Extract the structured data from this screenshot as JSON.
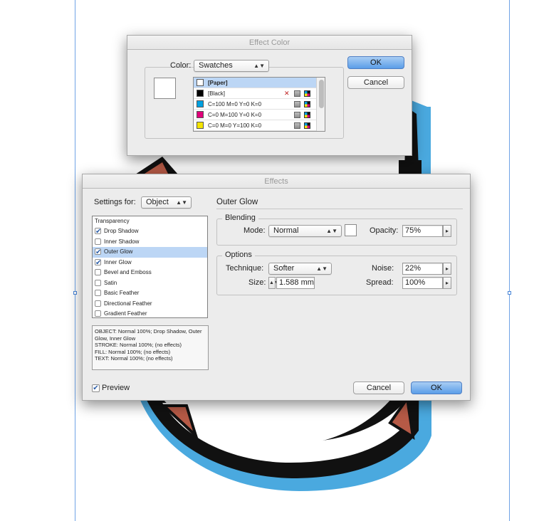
{
  "canvas": {
    "guide_color": "#6fa3e6",
    "art_colors": {
      "outline": "#111111",
      "glow": "#4aa9df",
      "fill": "#b65a46"
    }
  },
  "effect_color_dialog": {
    "title": "Effect Color",
    "color_label": "Color:",
    "color_source": "Swatches",
    "swatches": [
      {
        "name": "[Paper]",
        "color": "#ffffff",
        "selected": true,
        "bold": true,
        "icons": []
      },
      {
        "name": "[Black]",
        "color": "#000000",
        "selected": false,
        "bold": false,
        "icons": [
          "no-edit-icon",
          "process-color-icon",
          "cmyk-icon"
        ]
      },
      {
        "name": "C=100 M=0 Y=0 K=0",
        "color": "#00a0e0",
        "selected": false,
        "bold": false,
        "icons": [
          "process-color-icon",
          "cmyk-icon"
        ]
      },
      {
        "name": "C=0 M=100 Y=0 K=0",
        "color": "#e0007a",
        "selected": false,
        "bold": false,
        "icons": [
          "process-color-icon",
          "cmyk-icon"
        ]
      },
      {
        "name": "C=0 M=0 Y=100 K=0",
        "color": "#f4e400",
        "selected": false,
        "bold": false,
        "icons": [
          "process-color-icon",
          "cmyk-icon"
        ]
      }
    ],
    "ok_label": "OK",
    "cancel_label": "Cancel"
  },
  "effects_dialog": {
    "title": "Effects",
    "settings_for_label": "Settings for:",
    "settings_for_value": "Object",
    "section_title": "Outer Glow",
    "effects_header": "Transparency",
    "effects": [
      {
        "label": "Drop Shadow",
        "checked": true,
        "selected": false
      },
      {
        "label": "Inner Shadow",
        "checked": false,
        "selected": false
      },
      {
        "label": "Outer Glow",
        "checked": true,
        "selected": true
      },
      {
        "label": "Inner Glow",
        "checked": true,
        "selected": false
      },
      {
        "label": "Bevel and Emboss",
        "checked": false,
        "selected": false
      },
      {
        "label": "Satin",
        "checked": false,
        "selected": false
      },
      {
        "label": "Basic Feather",
        "checked": false,
        "selected": false
      },
      {
        "label": "Directional Feather",
        "checked": false,
        "selected": false
      },
      {
        "label": "Gradient Feather",
        "checked": false,
        "selected": false
      }
    ],
    "summary": [
      "OBJECT: Normal 100%; Drop Shadow, Outer Glow, Inner Glow",
      "STROKE: Normal 100%; (no effects)",
      "FILL: Normal 100%; (no effects)",
      "TEXT: Normal 100%; (no effects)"
    ],
    "blending": {
      "title": "Blending",
      "mode_label": "Mode:",
      "mode_value": "Normal",
      "swatch_color": "#ffffff",
      "opacity_label": "Opacity:",
      "opacity_value": "75%"
    },
    "options": {
      "title": "Options",
      "technique_label": "Technique:",
      "technique_value": "Softer",
      "noise_label": "Noise:",
      "noise_value": "22%",
      "size_label": "Size:",
      "size_value": "1.588 mm",
      "spread_label": "Spread:",
      "spread_value": "100%"
    },
    "preview_label": "Preview",
    "preview_checked": true,
    "cancel_label": "Cancel",
    "ok_label": "OK"
  }
}
